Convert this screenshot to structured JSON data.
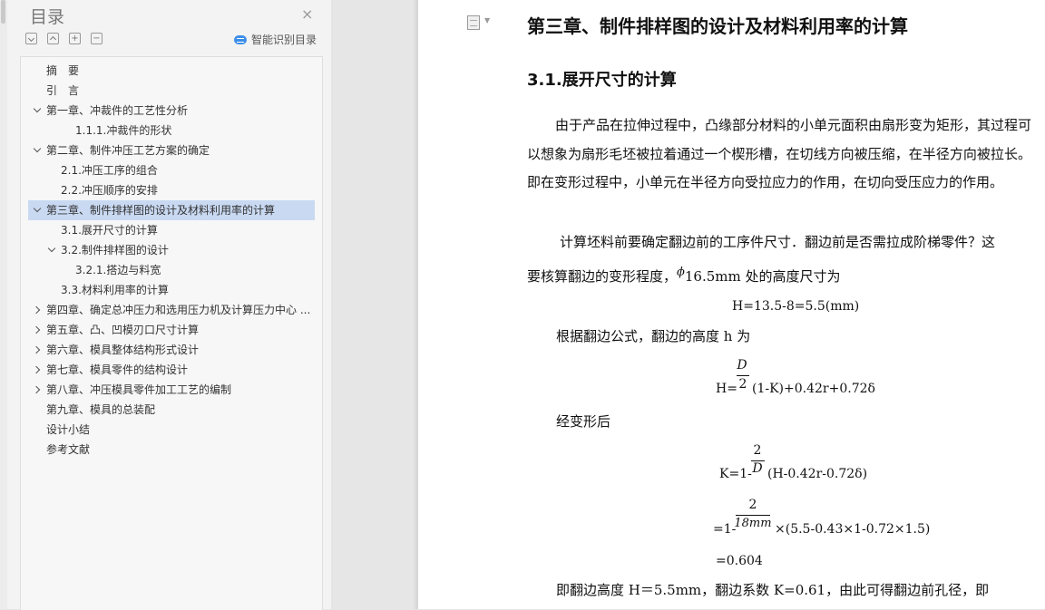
{
  "toc": {
    "title": "目录",
    "close_icon": "×",
    "toolbar": {
      "collapse_all": "−",
      "expand_all": "+",
      "add": "+",
      "remove": "−"
    },
    "smart_label": "智能识别目录",
    "items": [
      {
        "label": "摘　要",
        "level": 0,
        "chevron": ""
      },
      {
        "label": "引　言",
        "level": 0,
        "chevron": ""
      },
      {
        "label": "第一章、冲裁件的工艺性分析",
        "level": 0,
        "chevron": "down"
      },
      {
        "label": "1.1.1.冲裁件的形状",
        "level": 2,
        "chevron": ""
      },
      {
        "label": "第二章、制件冲压工艺方案的确定",
        "level": 0,
        "chevron": "down"
      },
      {
        "label": "2.1.冲压工序的组合",
        "level": 1,
        "chevron": ""
      },
      {
        "label": "2.2.冲压顺序的安排",
        "level": 1,
        "chevron": ""
      },
      {
        "label": "第三章、制件排样图的设计及材料利用率的计算",
        "level": 0,
        "chevron": "down",
        "selected": true
      },
      {
        "label": "3.1.展开尺寸的计算",
        "level": 1,
        "chevron": ""
      },
      {
        "label": "3.2.制件排样图的设计",
        "level": 1,
        "chevron": "down"
      },
      {
        "label": "3.2.1.搭边与料宽",
        "level": 2,
        "chevron": ""
      },
      {
        "label": "3.3.材料利用率的计算",
        "level": 1,
        "chevron": ""
      },
      {
        "label": "第四章、确定总冲压力和选用压力机及计算压力中心 ...",
        "level": 0,
        "chevron": "right"
      },
      {
        "label": "第五章、凸、凹模刃口尺寸计算",
        "level": 0,
        "chevron": "right"
      },
      {
        "label": "第六章、模具整体结构形式设计",
        "level": 0,
        "chevron": "right"
      },
      {
        "label": "第七章、模具零件的结构设计",
        "level": 0,
        "chevron": "right"
      },
      {
        "label": "第八章、冲压模具零件加工工艺的编制",
        "level": 0,
        "chevron": "right"
      },
      {
        "label": "第九章、模具的总装配",
        "level": 0,
        "chevron": ""
      },
      {
        "label": "设计小结",
        "level": 0,
        "chevron": ""
      },
      {
        "label": "参考文献",
        "level": 0,
        "chevron": ""
      }
    ]
  },
  "doc": {
    "chapter_title": "第三章、制件排样图的设计及材料利用率的计算",
    "section_title": "3.1.展开尺寸的计算",
    "para1": "由于产品在拉伸过程中，凸缘部分材料的小单元面积由扇形变为矩形，其过程可以想象为扇形毛坯被拉着通过一个楔形槽，在切线方向被压缩，在半径方向被拉长。即在变形过程中，小单元在半径方向受拉应力的作用，在切向受压应力的作用。",
    "para2_line1": "计算坯料前要确定翻边前的工序件尺寸．翻边前是否需拉成阶梯零件？这",
    "para2_line2_a": "要核算翻边的变形程度，",
    "para2_phi": "ϕ",
    "para2_line2_b": "16.5mm 处的高度尺寸为",
    "formula_h": "H=13.5-8=5.5(mm)",
    "para3": "根据翻边公式，翻边的高度 h 为",
    "f2_num": "D",
    "f2_den": "2",
    "f2_prefix": "H=",
    "f2_suffix": "(1-K)+0.42r+0.72δ",
    "para4": "经变形后",
    "f3_num": "2",
    "f3_den": "D",
    "f3_prefix": "K=1-",
    "f3_suffix": "(H-0.42r-0.72δ)",
    "f4_num": "2",
    "f4_den": "18mm",
    "f4_prefix": "=1-",
    "f4_suffix": "×(5.5-0.43×1-0.72×1.5)",
    "f5": "=0.604",
    "para5": "即翻边高度 H＝5.5mm，翻边系数 K=0.61，由此可得翻边前孔径，即"
  }
}
